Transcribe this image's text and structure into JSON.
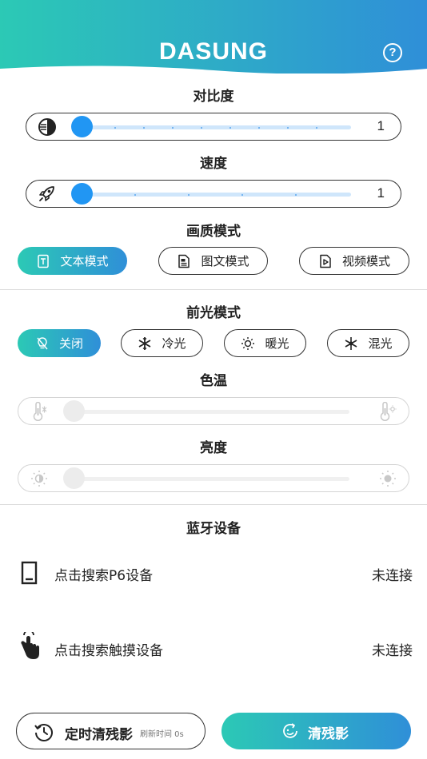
{
  "header": {
    "brand": "DASUNG",
    "help_symbol": "?"
  },
  "contrast": {
    "title": "对比度",
    "value": 1,
    "max": 9,
    "display_value": "1",
    "icon": "contrast-icon"
  },
  "speed": {
    "title": "速度",
    "value": 1,
    "max": 6,
    "display_value": "1",
    "icon": "rocket-icon"
  },
  "quality": {
    "title": "画质模式",
    "modes": [
      {
        "label": "文本模式",
        "icon": "text-doc-icon",
        "active": true
      },
      {
        "label": "图文模式",
        "icon": "image-text-icon",
        "active": false
      },
      {
        "label": "视频模式",
        "icon": "video-icon",
        "active": false
      }
    ]
  },
  "frontlight": {
    "title": "前光模式",
    "modes": [
      {
        "label": "关闭",
        "icon": "light-off-icon",
        "active": true
      },
      {
        "label": "冷光",
        "icon": "snowflake-icon",
        "active": false
      },
      {
        "label": "暖光",
        "icon": "sun-icon",
        "active": false
      },
      {
        "label": "混光",
        "icon": "mixed-light-icon",
        "active": false
      }
    ]
  },
  "color_temp": {
    "title": "色温",
    "value": 0,
    "enabled": false,
    "left_icon": "thermometer-cold-icon",
    "right_icon": "thermometer-warm-icon"
  },
  "brightness": {
    "title": "亮度",
    "value": 0,
    "enabled": false,
    "left_icon": "dim-sun-icon",
    "right_icon": "bright-sun-icon"
  },
  "bluetooth": {
    "title": "蓝牙设备",
    "devices": [
      {
        "label": "点击搜索P6设备",
        "status": "未连接",
        "icon": "monitor-device-icon"
      },
      {
        "label": "点击搜索触摸设备",
        "status": "未连接",
        "icon": "touch-hand-icon"
      }
    ]
  },
  "bottom": {
    "timer_label": "定时清残影",
    "timer_sub": "刷新时间 0s",
    "clear_label": "清残影"
  },
  "colors": {
    "accent_start": "#2cc9b5",
    "accent_end": "#2f8fd8",
    "slider_blue": "#2196f3"
  }
}
